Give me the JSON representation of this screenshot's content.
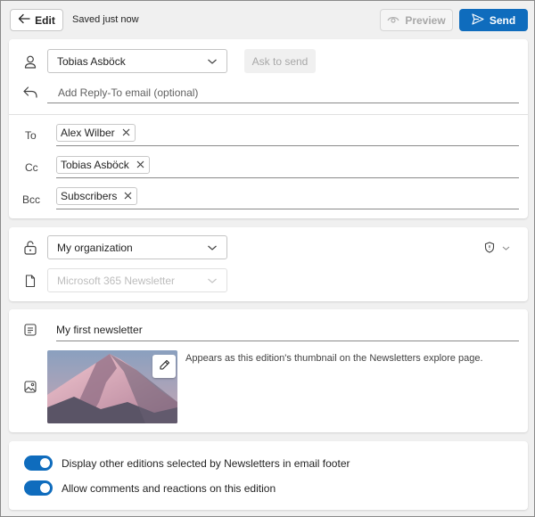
{
  "toolbar": {
    "edit_label": "Edit",
    "saved_status": "Saved just now",
    "preview_label": "Preview",
    "send_label": "Send"
  },
  "sender": {
    "from_value": "Tobias Asböck",
    "ask_to_send_label": "Ask to send",
    "reply_to_placeholder": "Add Reply-To email (optional)"
  },
  "recipients": {
    "to_label": "To",
    "cc_label": "Cc",
    "bcc_label": "Bcc",
    "to_chips": [
      "Alex Wilber"
    ],
    "cc_chips": [
      "Tobias Asböck"
    ],
    "bcc_chips": [
      "Subscribers"
    ]
  },
  "audience": {
    "visibility_value": "My organization",
    "newsletter_value": "Microsoft 365 Newsletter"
  },
  "content": {
    "title_value": "My first newsletter",
    "thumbnail_description": "Appears as this edition's thumbnail on the Newsletters explore page."
  },
  "options": {
    "toggles": [
      {
        "label": "Display other editions selected by Newsletters in email footer",
        "on": true
      },
      {
        "label": "Allow comments and reactions on this edition",
        "on": true
      }
    ]
  },
  "colors": {
    "accent": "#0f6cbd",
    "background": "#f0f0f0",
    "card": "#ffffff"
  }
}
